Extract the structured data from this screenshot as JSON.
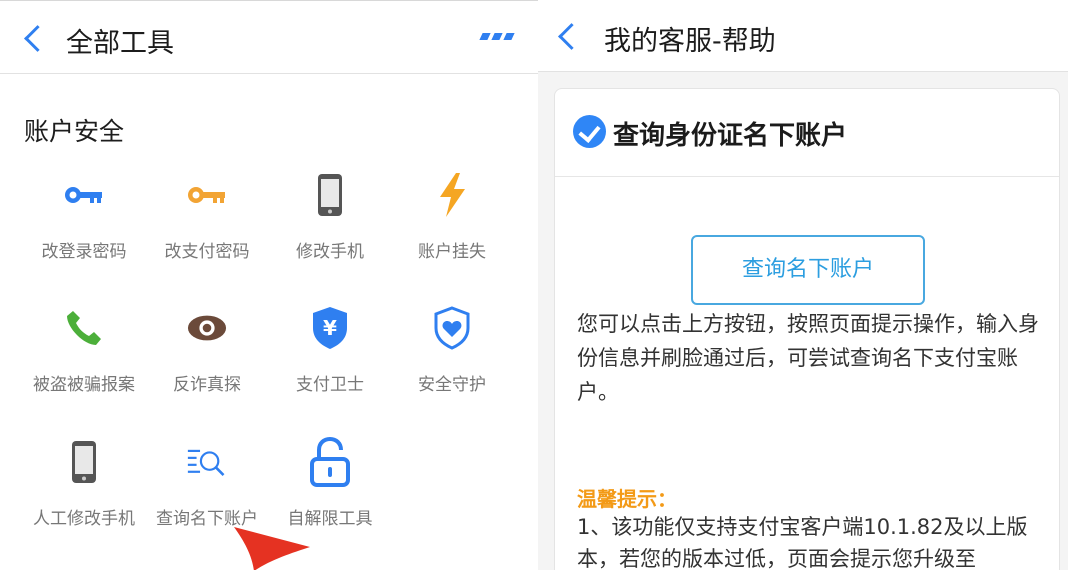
{
  "left_panel": {
    "nav": {
      "title": "全部工具"
    },
    "section_title": "账户安全",
    "tools": [
      {
        "label": "改登录密码",
        "icon": "key-icon",
        "color": "#2f7ff0"
      },
      {
        "label": "改支付密码",
        "icon": "key-icon",
        "color": "#f2a434"
      },
      {
        "label": "修改手机",
        "icon": "phone-icon",
        "color": "#555555"
      },
      {
        "label": "账户挂失",
        "icon": "lightning-icon",
        "color": "#f5a623"
      },
      {
        "label": "被盗被骗报案",
        "icon": "phone-call-icon",
        "color": "#4caf3a"
      },
      {
        "label": "反诈真探",
        "icon": "eye-icon",
        "color": "#6b4a3a"
      },
      {
        "label": "支付卫士",
        "icon": "yuan-shield-icon",
        "color": "#2f7ff0"
      },
      {
        "label": "安全守护",
        "icon": "heart-shield-icon",
        "color": "#2f7ff0"
      },
      {
        "label": "人工修改手机",
        "icon": "phone-icon",
        "color": "#555555"
      },
      {
        "label": "查询名下账户",
        "icon": "list-search-icon",
        "color": "#2f7ff0"
      },
      {
        "label": "自解限工具",
        "icon": "unlock-icon",
        "color": "#2f7ff0"
      }
    ]
  },
  "right_panel": {
    "nav": {
      "title": "我的客服-帮助"
    },
    "card": {
      "title": "查询身份证名下账户",
      "button_label": "查询名下账户",
      "description": "您可以点击上方按钮，按照页面提示操作，输入身份信息并刷脸通过后，可尝试查询名下支付宝账户。",
      "tip_title": "温馨提示：",
      "tip_text": "1、该功能仅支持支付宝客户端10.1.82及以上版本，若您的版本过低，页面会提示您升级至"
    }
  },
  "colors": {
    "accent": "#2f7ff0",
    "warning": "#f39a17",
    "button_border": "#48a8e0"
  }
}
